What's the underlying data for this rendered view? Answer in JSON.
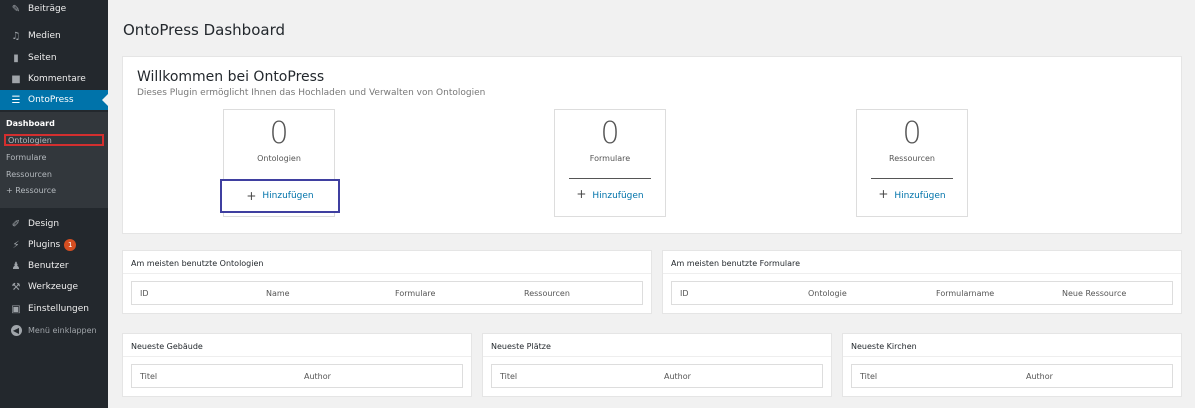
{
  "sidebar": {
    "items": [
      {
        "label": "Beiträge",
        "icon": "pin-icon"
      },
      {
        "label": "Medien",
        "icon": "media-icon"
      },
      {
        "label": "Seiten",
        "icon": "pages-icon"
      },
      {
        "label": "Kommentare",
        "icon": "comment-icon"
      },
      {
        "label": "OntoPress",
        "icon": "list-icon"
      },
      {
        "label": "Design",
        "icon": "brush-icon"
      },
      {
        "label": "Plugins",
        "icon": "plugin-icon",
        "badge": "1"
      },
      {
        "label": "Benutzer",
        "icon": "user-icon"
      },
      {
        "label": "Werkzeuge",
        "icon": "wrench-icon"
      },
      {
        "label": "Einstellungen",
        "icon": "settings-icon"
      },
      {
        "label": "Menü einklappen",
        "icon": "collapse-icon"
      }
    ],
    "submenu": [
      "Dashboard",
      "Ontologien",
      "Formulare",
      "Ressourcen",
      "+ Ressource"
    ]
  },
  "page": {
    "title": "OntoPress Dashboard"
  },
  "welcome": {
    "title": "Willkommen bei OntoPress",
    "description": "Dieses Plugin ermöglicht Ihnen das Hochladen und Verwalten von Ontologien"
  },
  "stats": [
    {
      "count": "0",
      "label": "Ontologien",
      "add": "Hinzufügen"
    },
    {
      "count": "0",
      "label": "Formulare",
      "add": "Hinzufügen"
    },
    {
      "count": "0",
      "label": "Ressourcen",
      "add": "Hinzufügen"
    }
  ],
  "panels": {
    "ontologies": {
      "title": "Am meisten benutzte Ontologien",
      "columns": [
        "ID",
        "Name",
        "Formulare",
        "Ressourcen"
      ]
    },
    "forms": {
      "title": "Am meisten benutzte Formulare",
      "columns": [
        "ID",
        "Ontologie",
        "Formularname",
        "Neue Ressource"
      ]
    },
    "buildings": {
      "title": "Neueste Gebäude",
      "columns": [
        "Titel",
        "Author"
      ]
    },
    "places": {
      "title": "Neueste Plätze",
      "columns": [
        "Titel",
        "Author"
      ]
    },
    "churches": {
      "title": "Neueste Kirchen",
      "columns": [
        "Titel",
        "Author"
      ]
    }
  },
  "colors": {
    "accent": "#0073aa",
    "sidebar": "#23282d",
    "highlight_red": "#d32f2f",
    "highlight_blue": "#3f3fa0"
  }
}
